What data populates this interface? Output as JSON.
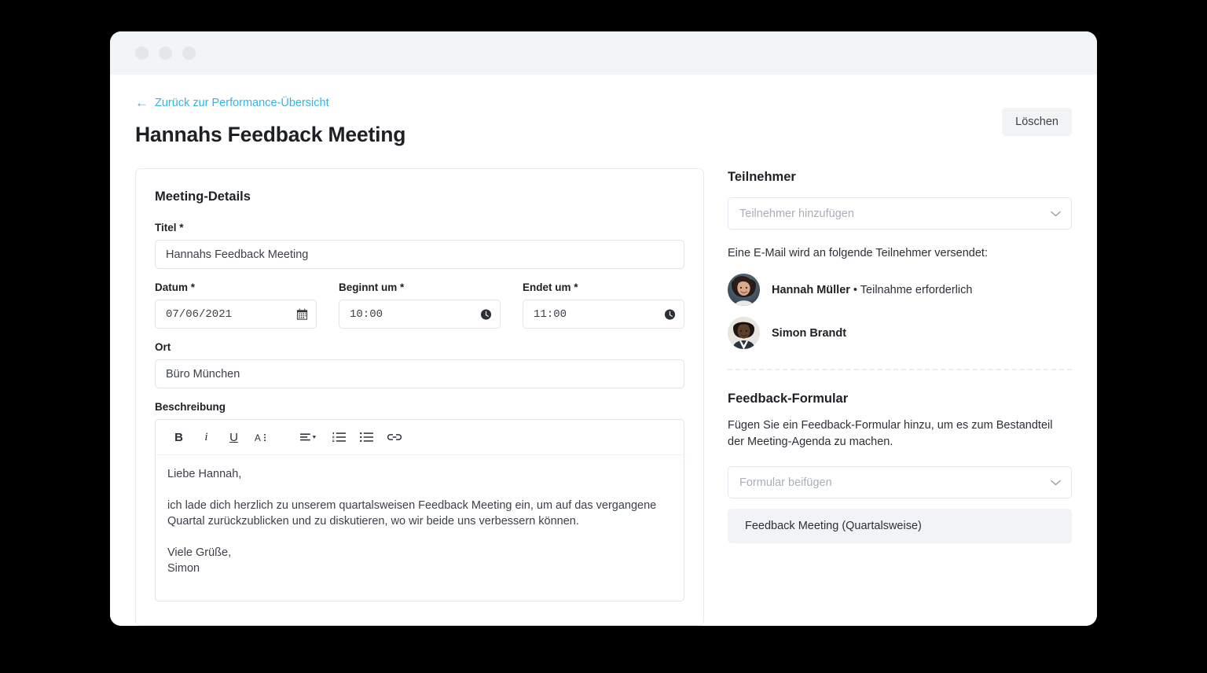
{
  "window": {
    "dots": [
      "close-dot",
      "minimize-dot",
      "maximize-dot"
    ]
  },
  "header": {
    "back_link": "Zurück zur Performance-Übersicht",
    "back_arrow": "←",
    "title": "Hannahs Feedback Meeting",
    "delete_label": "Löschen"
  },
  "details_card": {
    "title": "Meeting-Details",
    "fields": {
      "titel_label": "Titel *",
      "titel_value": "Hannahs Feedback Meeting",
      "datum_label": "Datum *",
      "datum_value": "07/06/2021",
      "beginnt_label": "Beginnt um *",
      "beginnt_value": "10:00",
      "endet_label": "Endet um *",
      "endet_value": "11:00",
      "ort_label": "Ort",
      "ort_value": "Büro München",
      "beschreibung_label": "Beschreibung"
    },
    "toolbar": {
      "bold": "B",
      "italic": "i",
      "underline": "U",
      "text_style": "A",
      "align": "align",
      "ordered_list": "ordered-list",
      "bullet_list": "bullet-list",
      "link": "link"
    },
    "description_body": "Liebe Hannah,\n\nich lade dich herzlich zu unserem quartalsweisen Feedback Meeting ein, um auf das vergangene Quartal zurückzublicken und zu diskutieren, wo wir beide uns verbessern können.\n\nViele Grüße,\nSimon"
  },
  "sidebar": {
    "attendees": {
      "title": "Teilnehmer",
      "select_placeholder": "Teilnehmer hinzufügen",
      "email_note": "Eine E-Mail wird an folgende Teilnehmer versendet:",
      "list": [
        {
          "name": "Hannah Müller",
          "separator": " • ",
          "status": "Teilnahme erforderlich"
        },
        {
          "name": "Simon Brandt",
          "separator": "",
          "status": ""
        }
      ]
    },
    "feedback_form": {
      "title": "Feedback-Formular",
      "description": "Fügen Sie ein Feedback-Formular hinzu, um es zum Bestandteil der Meeting-Agenda zu machen.",
      "select_placeholder": "Formular beifügen",
      "selected_form": "Feedback Meeting (Quartalsweise)"
    }
  },
  "colors": {
    "link": "#2fb6e9",
    "titlebar": "#f2f5f8",
    "border": "#dfe5ec",
    "text": "#1d2025",
    "placeholder": "#a8afb9",
    "selected_bg": "#f1f3f6"
  }
}
